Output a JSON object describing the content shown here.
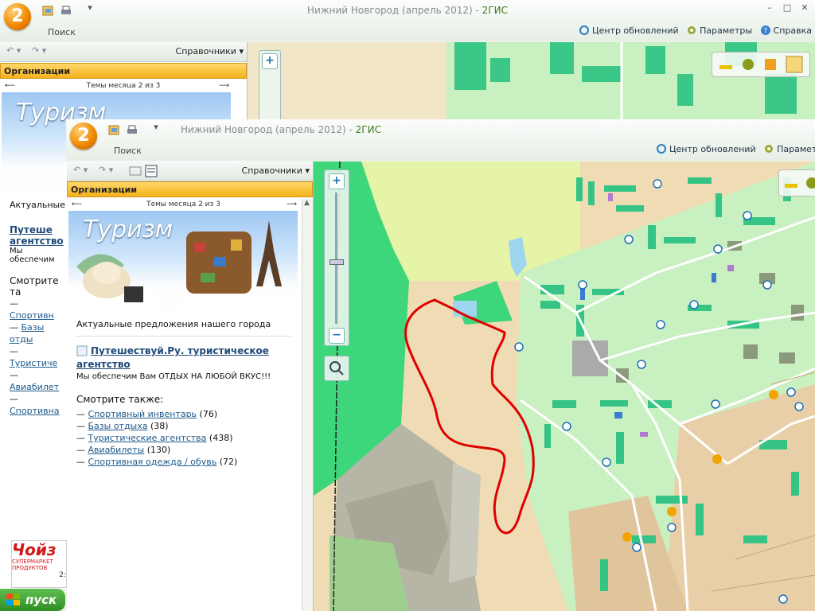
{
  "window": {
    "title_prefix": "Нижний Новгород (апрель 2012) - ",
    "title_brand": "2ГИС",
    "logo_text": "2",
    "search_label": "Поиск",
    "min_symbol": "–",
    "max_symbol": "□",
    "close_symbol": "✕",
    "update_center": "Центр обновлений",
    "params": "Параметры",
    "help": "Справка"
  },
  "panel": {
    "directories": "Справочники",
    "organizations": "Организации",
    "themes_of_month": "Темы месяца 2 из 3",
    "banner_title": "Туризм",
    "subtitle": "Актуальные предложения нашего города",
    "featured_link": "Путешествуй.Ру. туристическое агентство",
    "featured_desc": "Мы обеспечим Вам ОТДЫХ НА ЛЮБОЙ ВКУС!!!",
    "see_also": "Смотрите также:",
    "see_also_items": [
      {
        "label": "Спортивный инвентарь",
        "count": "(76)"
      },
      {
        "label": "Базы отдыха",
        "count": "(38)"
      },
      {
        "label": "Туристические агентства",
        "count": "(438)"
      },
      {
        "label": "Авиабилеты",
        "count": "(130)"
      },
      {
        "label": "Спортивная одежда / обувь",
        "count": "(72)"
      }
    ]
  },
  "back_panel": {
    "banner_title": "Туризм",
    "subtitle": "Актуальные",
    "link_part1": "Путеше",
    "link_part2": "агентство",
    "desc": "Мы обеспечим",
    "see_also": "Смотрите та",
    "items": [
      "Спортивн",
      "Базы отды",
      "Туристиче",
      "Авиабилет",
      "Спортивна"
    ]
  },
  "ad": {
    "brand": "Чойз",
    "line1": "СУПЕРМАРКЕТ",
    "line2": "ПРОДУКТОВ",
    "line3": "2:"
  },
  "taskbar": {
    "start": "пуск"
  },
  "colors": {
    "accent": "#f4b21c",
    "route": "#e00000",
    "brand": "#3b7a1e"
  }
}
